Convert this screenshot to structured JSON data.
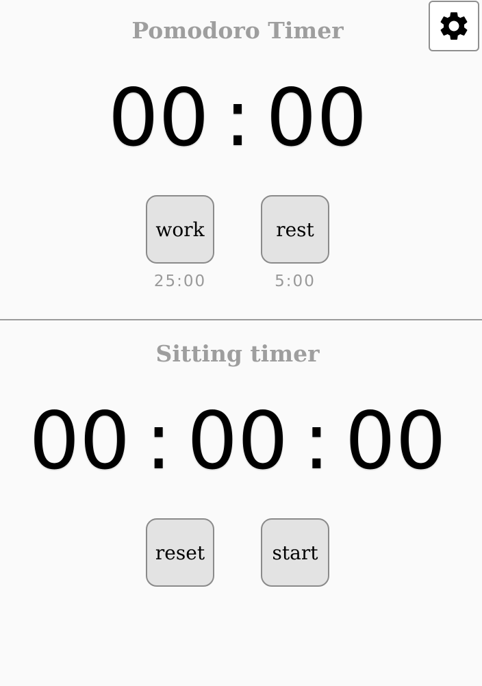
{
  "pomodoro": {
    "title": "Pomodoro Timer",
    "minutes": "00",
    "separator": ":",
    "seconds": "00",
    "work_label": "work",
    "rest_label": "rest",
    "work_duration": "25:00",
    "rest_duration": "5:00"
  },
  "sitting": {
    "title": "Sitting timer",
    "hours": "00",
    "separator": ":",
    "minutes": "00",
    "seconds": "00",
    "reset_label": "reset",
    "start_label": "start"
  },
  "settings": {
    "icon": "gear-icon"
  },
  "colors": {
    "background": "#fafafa",
    "title": "#9e9e9e",
    "button_bg": "#e3e3e3",
    "button_border": "#8a8a8a",
    "duration_text": "#999999",
    "divider": "#9a9a9a"
  }
}
